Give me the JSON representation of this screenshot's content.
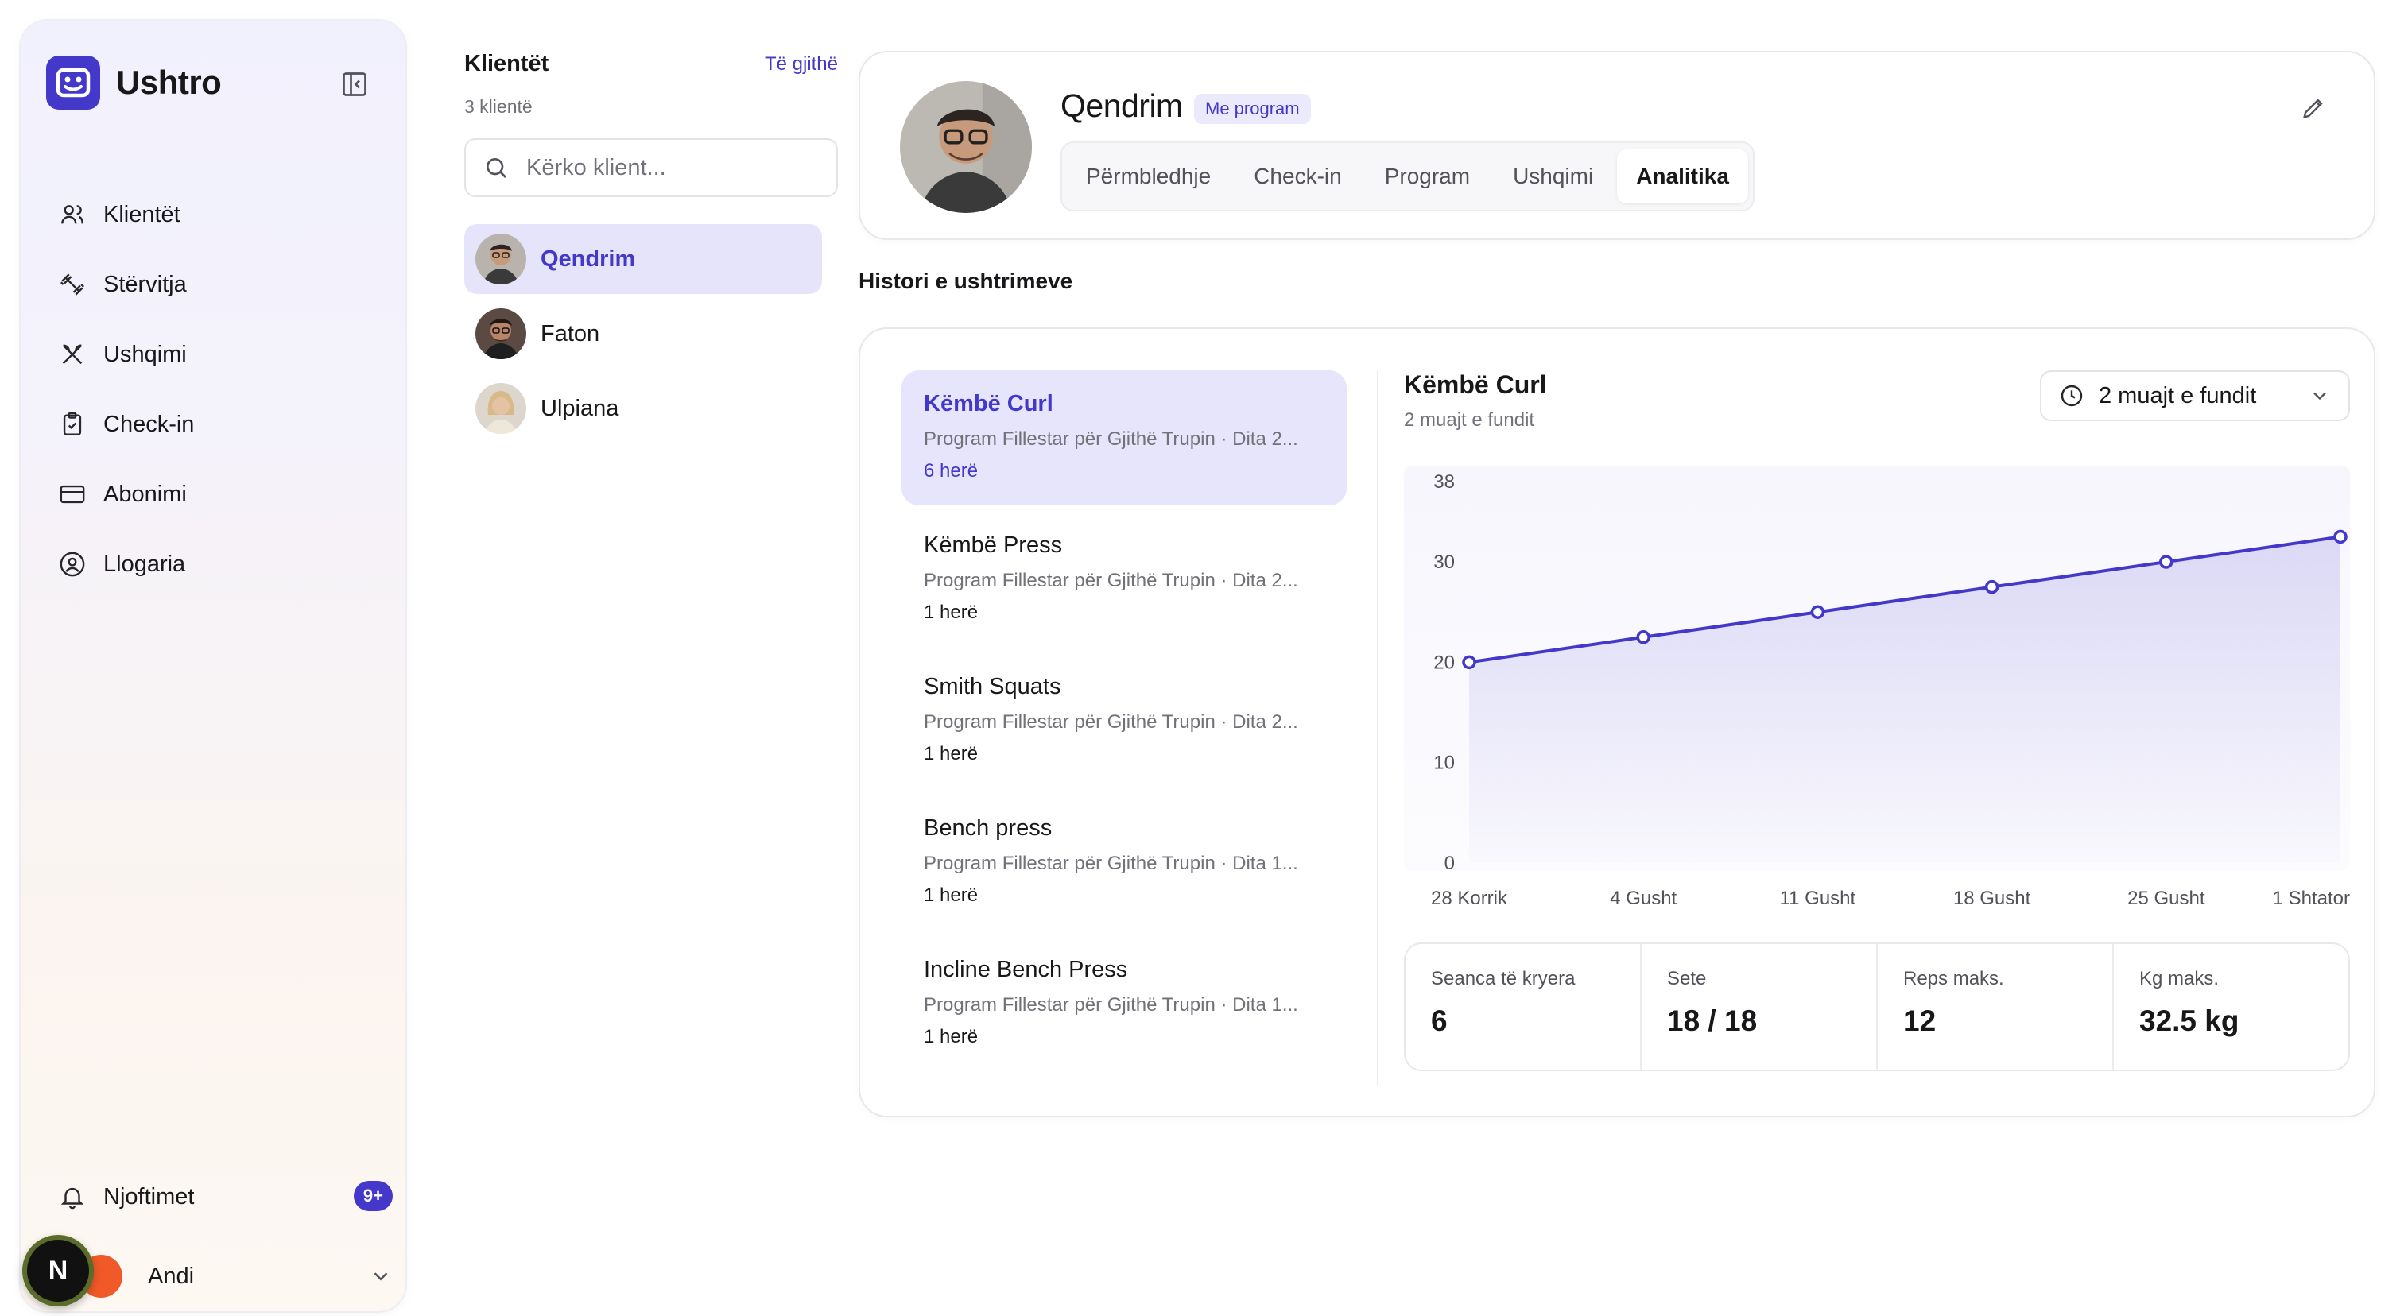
{
  "app": {
    "name": "Ushtro"
  },
  "sidebar": {
    "items": [
      {
        "label": "Klientët",
        "icon": "users-icon"
      },
      {
        "label": "Stërvitja",
        "icon": "dumbbell-icon"
      },
      {
        "label": "Ushqimi",
        "icon": "utensils-icon"
      },
      {
        "label": "Check-in",
        "icon": "clipboard-check-icon"
      },
      {
        "label": "Abonimi",
        "icon": "credit-card-icon"
      },
      {
        "label": "Llogaria",
        "icon": "user-circle-icon"
      }
    ],
    "notifications": {
      "label": "Njoftimet",
      "badge": "9+"
    },
    "user": {
      "name": "Andi"
    },
    "floating_badge": "N"
  },
  "clients": {
    "title": "Klientët",
    "see_all": "Të gjithë",
    "count": "3 klientë",
    "search_placeholder": "Kërko klient...",
    "list": [
      {
        "name": "Qendrim",
        "active": true
      },
      {
        "name": "Faton",
        "active": false
      },
      {
        "name": "Ulpiana",
        "active": false
      }
    ]
  },
  "profile": {
    "name": "Qendrim",
    "badge": "Me program",
    "tabs": [
      "Përmbledhje",
      "Check-in",
      "Program",
      "Ushqimi",
      "Analitika"
    ],
    "active_tab": "Analitika"
  },
  "history": {
    "title": "Histori e ushtrimeve",
    "exercises": [
      {
        "name": "Këmbë Curl",
        "program": "Program Fillestar për Gjithë Trupin · Dita 2...",
        "count": "6 herë",
        "active": true
      },
      {
        "name": "Këmbë Press",
        "program": "Program Fillestar për Gjithë Trupin · Dita 2...",
        "count": "1 herë",
        "active": false
      },
      {
        "name": "Smith Squats",
        "program": "Program Fillestar për Gjithë Trupin · Dita 2...",
        "count": "1 herë",
        "active": false
      },
      {
        "name": "Bench press",
        "program": "Program Fillestar për Gjithë Trupin · Dita 1...",
        "count": "1 herë",
        "active": false
      },
      {
        "name": "Incline Bench Press",
        "program": "Program Fillestar për Gjithë Trupin · Dita 1...",
        "count": "1 herë",
        "active": false
      }
    ]
  },
  "detail": {
    "title": "Këmbë Curl",
    "subtitle": "2 muajt e fundit",
    "range_label": "2 muajt e fundit"
  },
  "chart_data": {
    "type": "area",
    "categories": [
      "28 Korrik",
      "4 Gusht",
      "11 Gusht",
      "18 Gusht",
      "25 Gusht",
      "1 Shtator"
    ],
    "series": [
      {
        "values": [
          20,
          22.5,
          25,
          27.5,
          30,
          32.5
        ]
      }
    ],
    "yticks": [
      0,
      10,
      20,
      30,
      38
    ],
    "ylim": [
      0,
      38
    ],
    "grid": false,
    "color": "#4338ca"
  },
  "stats": [
    {
      "label": "Seanca të kryera",
      "value": "6"
    },
    {
      "label": "Sete",
      "value": "18 / 18"
    },
    {
      "label": "Reps maks.",
      "value": "12"
    },
    {
      "label": "Kg maks.",
      "value": "32.5 kg"
    }
  ]
}
